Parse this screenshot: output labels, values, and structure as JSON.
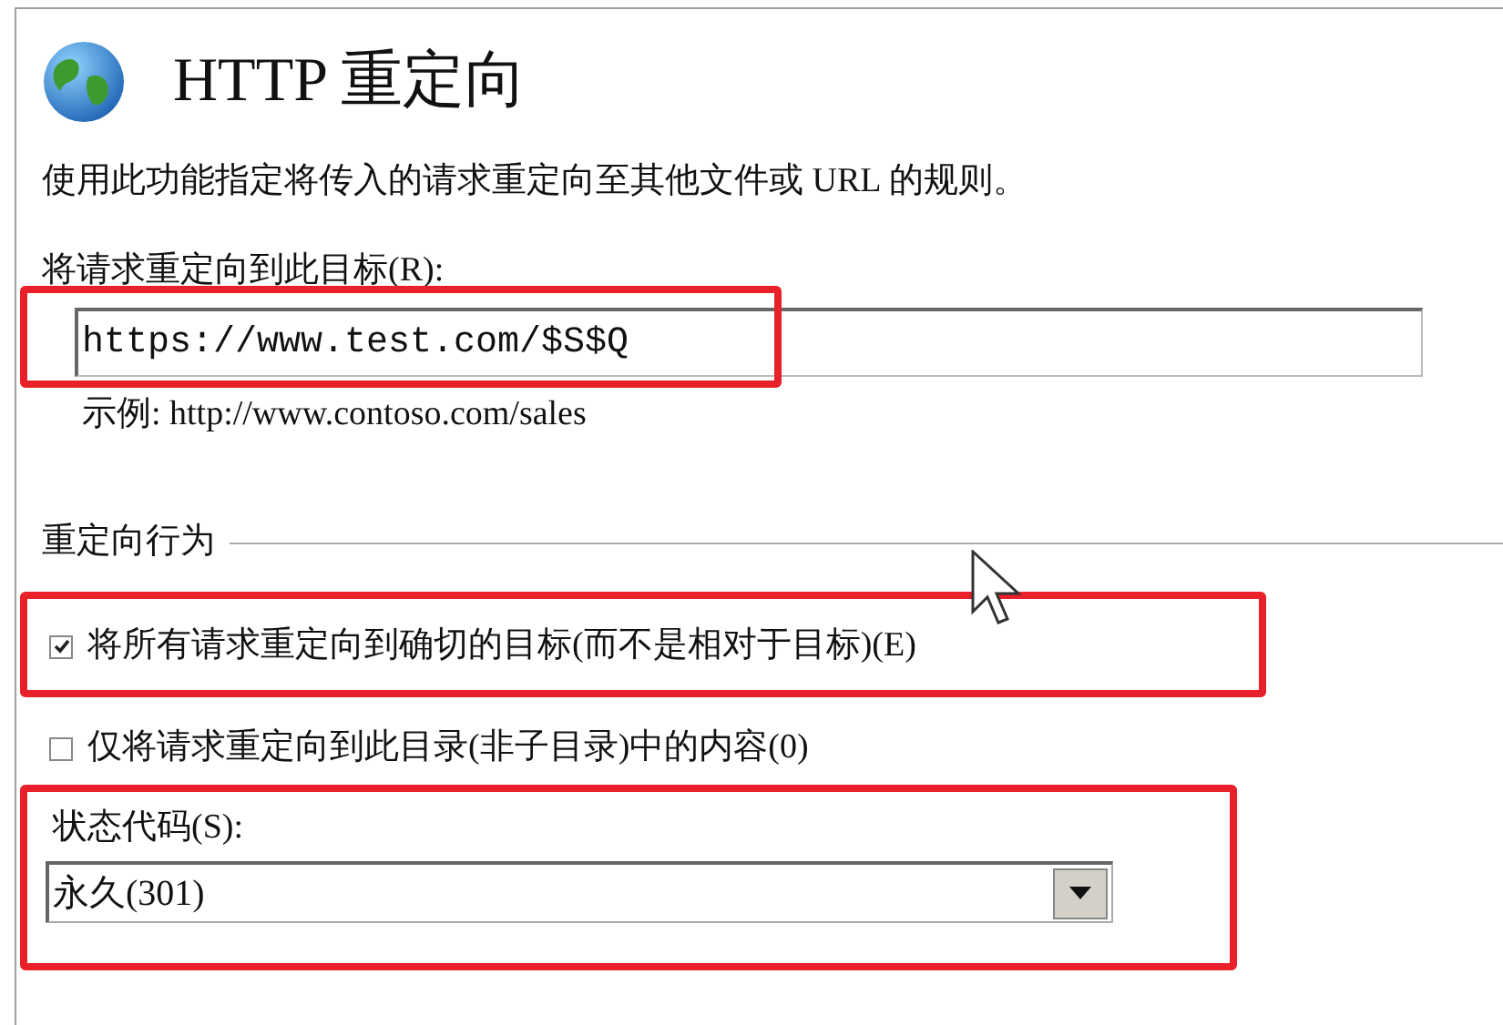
{
  "title": "HTTP 重定向",
  "description": "使用此功能指定将传入的请求重定向至其他文件或 URL 的规则。",
  "target": {
    "label": "将请求重定向到此目标(R):",
    "value": "https://www.test.com/$S$Q",
    "example": "示例: http://www.contoso.com/sales",
    "highlighted": true
  },
  "behavior": {
    "heading": "重定向行为",
    "options": [
      {
        "label": "将所有请求重定向到确切的目标(而不是相对于目标)(E)",
        "checked": true,
        "highlighted": true
      },
      {
        "label": "仅将请求重定向到此目录(非子目录)中的内容(0)",
        "checked": false,
        "highlighted": false
      }
    ]
  },
  "status_code": {
    "label": "状态代码(S):",
    "value": "永久(301)",
    "highlighted": true
  }
}
